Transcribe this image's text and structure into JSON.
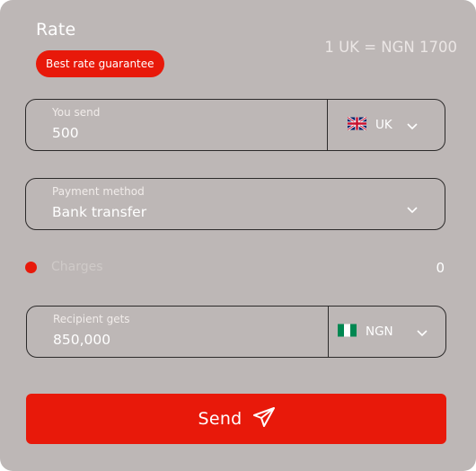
{
  "header": {
    "title": "Rate",
    "badge": "Best rate guarantee",
    "rate_text": "1 UK = NGN 1700"
  },
  "send_field": {
    "label": "You send",
    "value": "500",
    "currency": "UK",
    "flag_icon": "uk-flag-icon"
  },
  "payment_field": {
    "label": "Payment method",
    "value": "Bank transfer"
  },
  "charges": {
    "label": "Charges",
    "value": "0"
  },
  "recipient_field": {
    "label": "Recipient gets",
    "value": "850,000",
    "currency": "NGN",
    "flag_icon": "nigeria-flag-icon"
  },
  "send_button": {
    "label": "Send",
    "icon": "paper-plane-icon"
  },
  "colors": {
    "card_bg": "#bdb7b6",
    "accent": "#e8190a",
    "border": "#2c2a2a"
  }
}
